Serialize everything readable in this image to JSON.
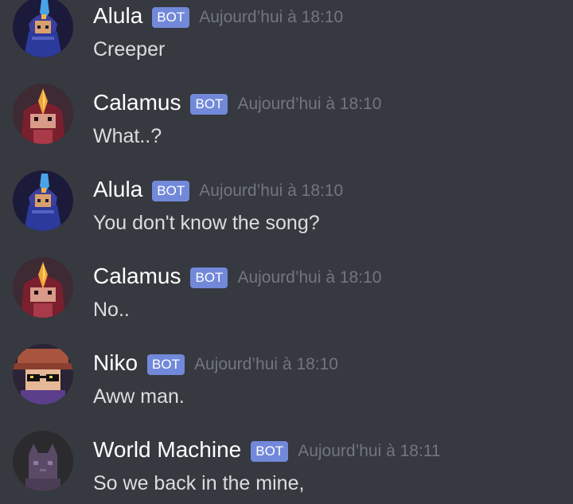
{
  "messages": [
    {
      "author": "Alula",
      "tag": "BOT",
      "timestamp": "Aujourd’hui à 18:10",
      "content": "Creeper",
      "avatar_icon": "alula-avatar-icon"
    },
    {
      "author": "Calamus",
      "tag": "BOT",
      "timestamp": "Aujourd’hui à 18:10",
      "content": "What..?",
      "avatar_icon": "calamus-avatar-icon"
    },
    {
      "author": "Alula",
      "tag": "BOT",
      "timestamp": "Aujourd’hui à 18:10",
      "content": "You don't know the song?",
      "avatar_icon": "alula-avatar-icon"
    },
    {
      "author": "Calamus",
      "tag": "BOT",
      "timestamp": "Aujourd’hui à 18:10",
      "content": "No..",
      "avatar_icon": "calamus-avatar-icon"
    },
    {
      "author": "Niko",
      "tag": "BOT",
      "timestamp": "Aujourd’hui à 18:10",
      "content": "Aww man.",
      "avatar_icon": "niko-avatar-icon"
    },
    {
      "author": "World Machine",
      "tag": "BOT",
      "timestamp": "Aujourd’hui à 18:11",
      "content": "So we back in the mine,",
      "avatar_icon": "world-machine-avatar-icon"
    }
  ],
  "colors": {
    "background": "#36393f",
    "username": "#ffffff",
    "bot_tag": "#7289da",
    "timestamp": "#72767d",
    "message_text": "#dcddde"
  }
}
